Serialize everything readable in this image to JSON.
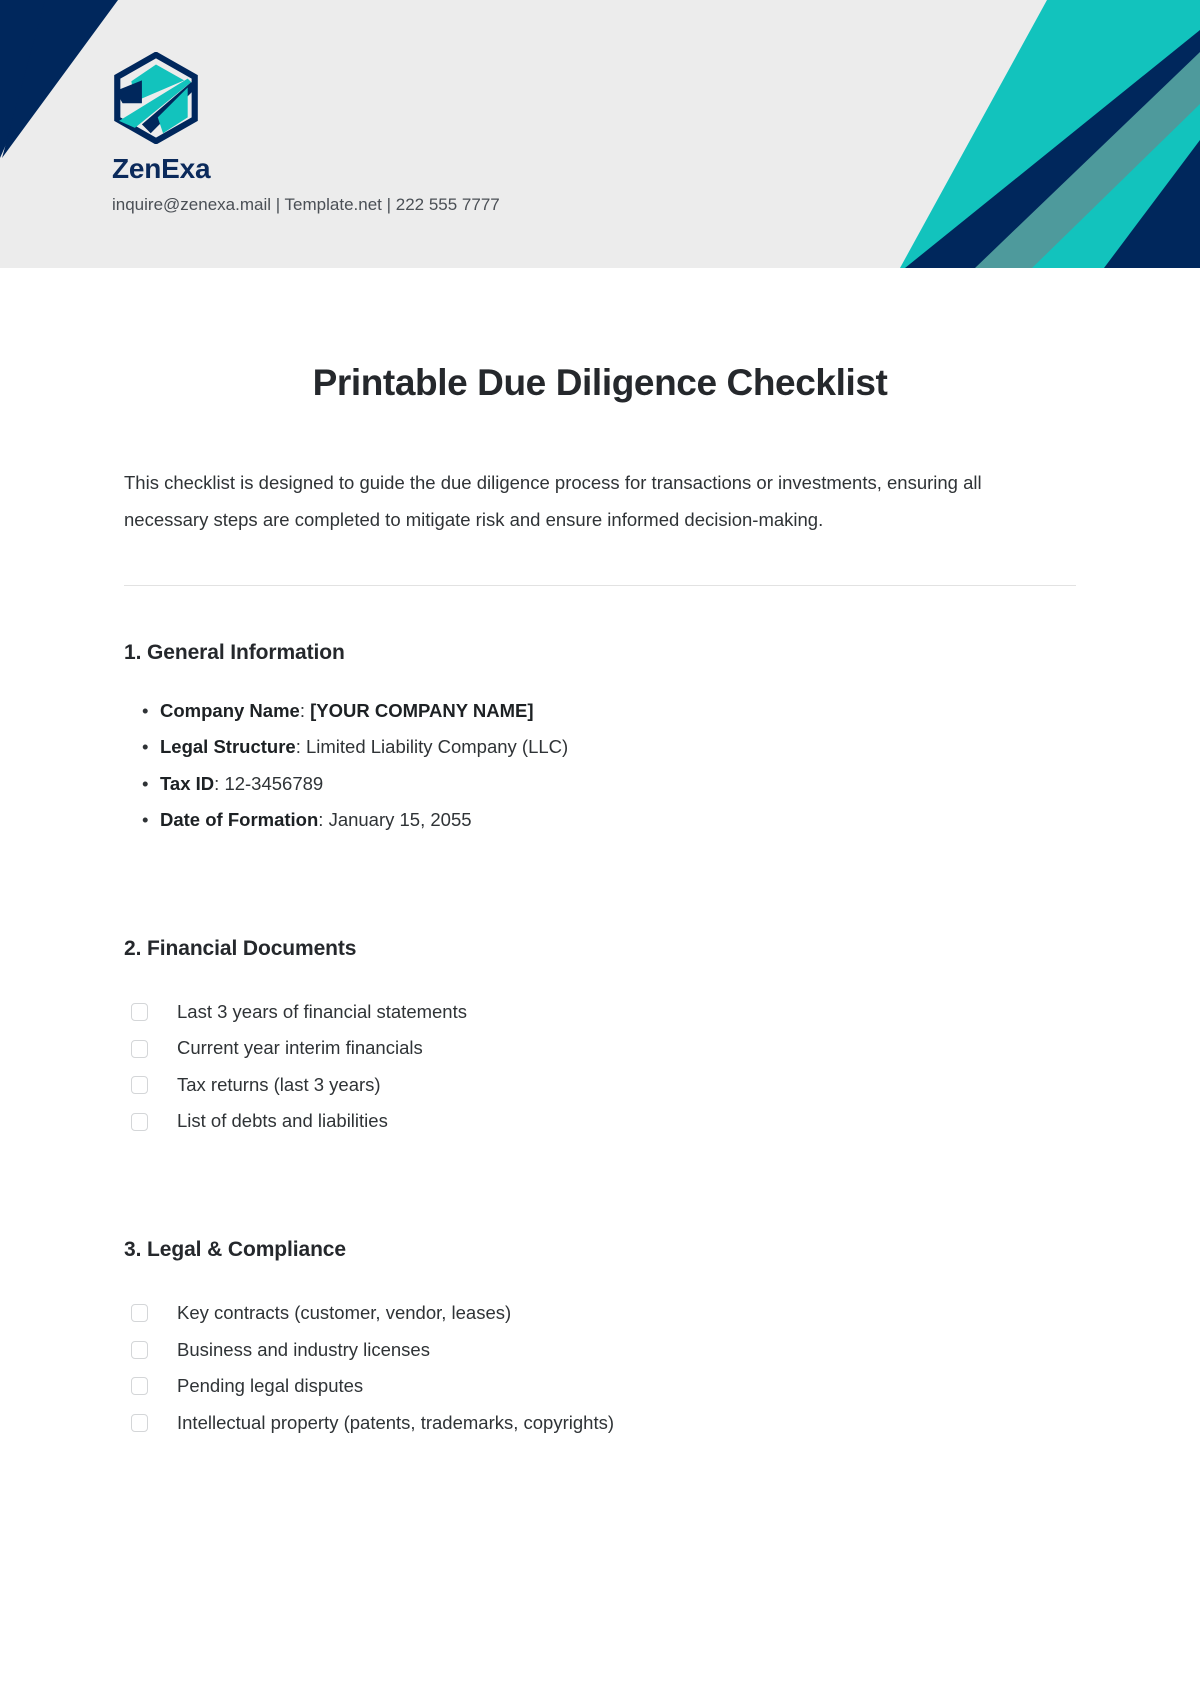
{
  "theme": {
    "header_bg": "#ececec",
    "navy": "#00275c",
    "teal": "#12c3bd",
    "slate_teal": "#4e9a9c",
    "brand_navy": "#0b2a5b",
    "text": "#2f3336",
    "divider": "#e2e2e2",
    "checkbox_border": "#d4d6d8"
  },
  "header": {
    "logo_icon": "zenexa-hexagon-logo",
    "brand_name": "ZenExa",
    "contact_line": "inquire@zenexa.mail | Template.net | 222 555 7777"
  },
  "document": {
    "title": "Printable Due Diligence Checklist",
    "intro": "This checklist is designed to guide the due diligence process for transactions or investments, ensuring all necessary steps are completed to mitigate risk and ensure informed decision-making."
  },
  "sections": [
    {
      "heading": "1. General Information",
      "type": "bullets",
      "items": [
        {
          "label": "Company Name",
          "separator": ": ",
          "value": "[YOUR COMPANY NAME]",
          "value_bold": true
        },
        {
          "label": "Legal Structure",
          "separator": ": ",
          "value": "Limited Liability Company (LLC)",
          "value_bold": false
        },
        {
          "label": "Tax ID",
          "separator": ": ",
          "value": "12-3456789",
          "value_bold": false
        },
        {
          "label": "Date of Formation",
          "separator": ": ",
          "value": "January 15, 2055",
          "value_bold": false
        }
      ]
    },
    {
      "heading": "2. Financial Documents",
      "type": "checkboxes",
      "items": [
        {
          "label": "Last 3 years of financial statements",
          "checked": false
        },
        {
          "label": "Current year interim financials",
          "checked": false
        },
        {
          "label": "Tax returns (last 3 years)",
          "checked": false
        },
        {
          "label": "List of debts and liabilities",
          "checked": false
        }
      ]
    },
    {
      "heading": "3. Legal & Compliance",
      "type": "checkboxes",
      "items": [
        {
          "label": "Key contracts (customer, vendor, leases)",
          "checked": false
        },
        {
          "label": "Business and industry licenses",
          "checked": false
        },
        {
          "label": "Pending legal disputes",
          "checked": false
        },
        {
          "label": "Intellectual property (patents, trademarks, copyrights)",
          "checked": false
        }
      ]
    }
  ]
}
